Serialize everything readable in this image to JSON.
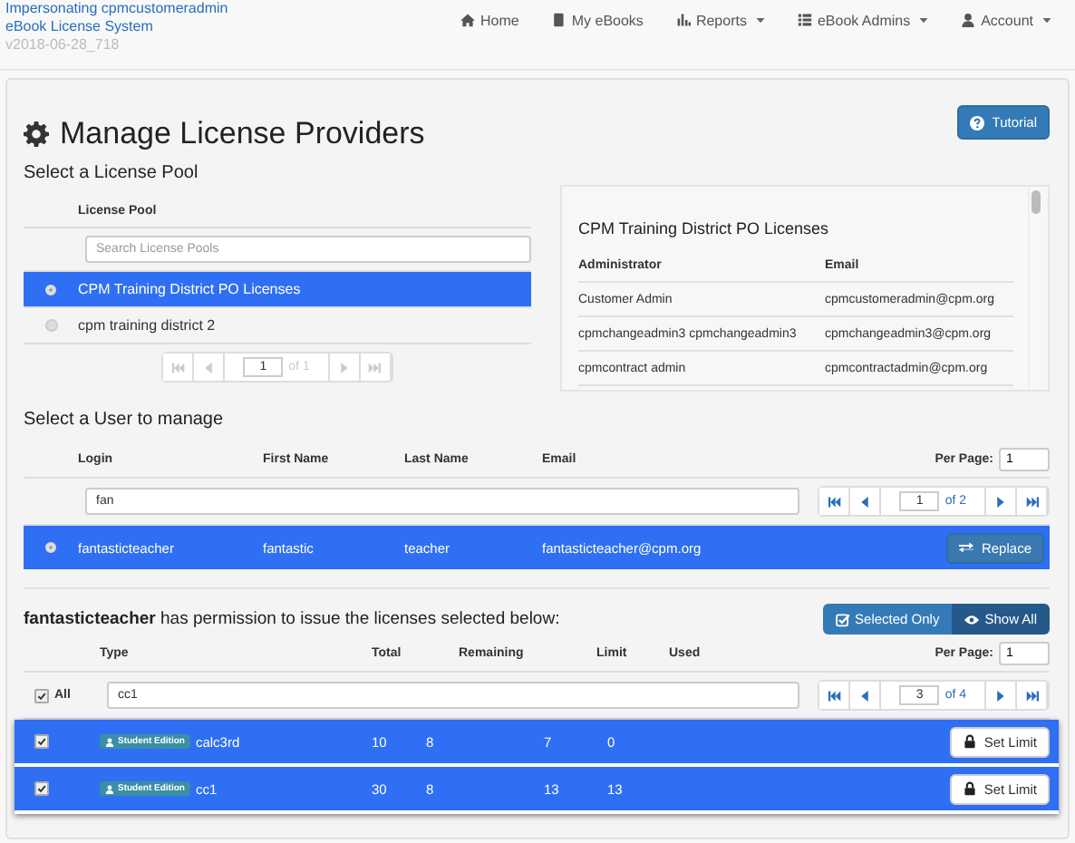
{
  "header": {
    "impersonating": "Impersonating cpmcustomeradmin",
    "system": "eBook License System",
    "version": "v2018-06-28_718"
  },
  "nav": [
    {
      "label": "Home",
      "kind": "home",
      "dropdown": false
    },
    {
      "label": "My eBooks",
      "kind": "book",
      "dropdown": false
    },
    {
      "label": "Reports",
      "kind": "chart",
      "dropdown": true
    },
    {
      "label": "eBook Admins",
      "kind": "list",
      "dropdown": true
    },
    {
      "label": "Account",
      "kind": "user",
      "dropdown": true
    }
  ],
  "title": "Manage License Providers",
  "tutorial_button": "Tutorial",
  "pool_section": {
    "heading": "Select a License Pool",
    "column": "License Pool",
    "search": {
      "placeholder": "Search License Pools"
    },
    "rows": [
      {
        "name": "CPM Training District PO Licenses",
        "selected": true
      },
      {
        "name": "cpm training district 2",
        "selected": false
      }
    ],
    "pager": {
      "page": "1",
      "of": "of 1"
    }
  },
  "pool_details": {
    "title": "CPM Training District PO Licenses",
    "columns": [
      "Administrator",
      "Email"
    ],
    "rows": [
      [
        "Customer Admin",
        "cpmcustomeradmin@cpm.org"
      ],
      [
        "cpmchangeadmin3 cpmchangeadmin3",
        "cpmchangeadmin3@cpm.org"
      ],
      [
        "cpmcontract admin",
        "cpmcontractadmin@cpm.org"
      ]
    ]
  },
  "user_section": {
    "heading": "Select a User to manage",
    "columns": [
      "Login",
      "First Name",
      "Last Name",
      "Email"
    ],
    "per_page_label": "Per Page:",
    "per_page": "1",
    "filter": "fan",
    "pager": {
      "page": "1",
      "of": "of 2"
    },
    "rows": [
      {
        "cells": [
          "fantasticteacher",
          "fantastic",
          "teacher",
          "fantasticteacher@cpm.org"
        ],
        "selected": true,
        "action": "Replace"
      }
    ]
  },
  "license_section": {
    "heading": "**fantasticteacher** has permission to issue the licenses selected below:",
    "toggle": [
      {
        "label": "Selected Only",
        "kind": "check",
        "selected": false
      },
      {
        "label": "Show All",
        "kind": "eye",
        "selected": true
      }
    ],
    "all_label": "All",
    "all_checked": true,
    "columns": [
      "Type",
      "Total",
      "Remaining",
      "Limit",
      "Used"
    ],
    "per_page_label": "Per Page:",
    "per_page": "1",
    "filter": "cc1",
    "pager": {
      "page": "3",
      "of": "of 4"
    },
    "rows": [
      {
        "badge": "Student Edition",
        "name": "calc3rd",
        "values": [
          "10",
          "8",
          "7",
          "0"
        ],
        "checked": true,
        "action": "Set Limit"
      },
      {
        "badge": "Student Edition",
        "name": "cc1",
        "values": [
          "30",
          "8",
          "13",
          "13"
        ],
        "checked": true,
        "action": "Set Limit"
      }
    ]
  }
}
